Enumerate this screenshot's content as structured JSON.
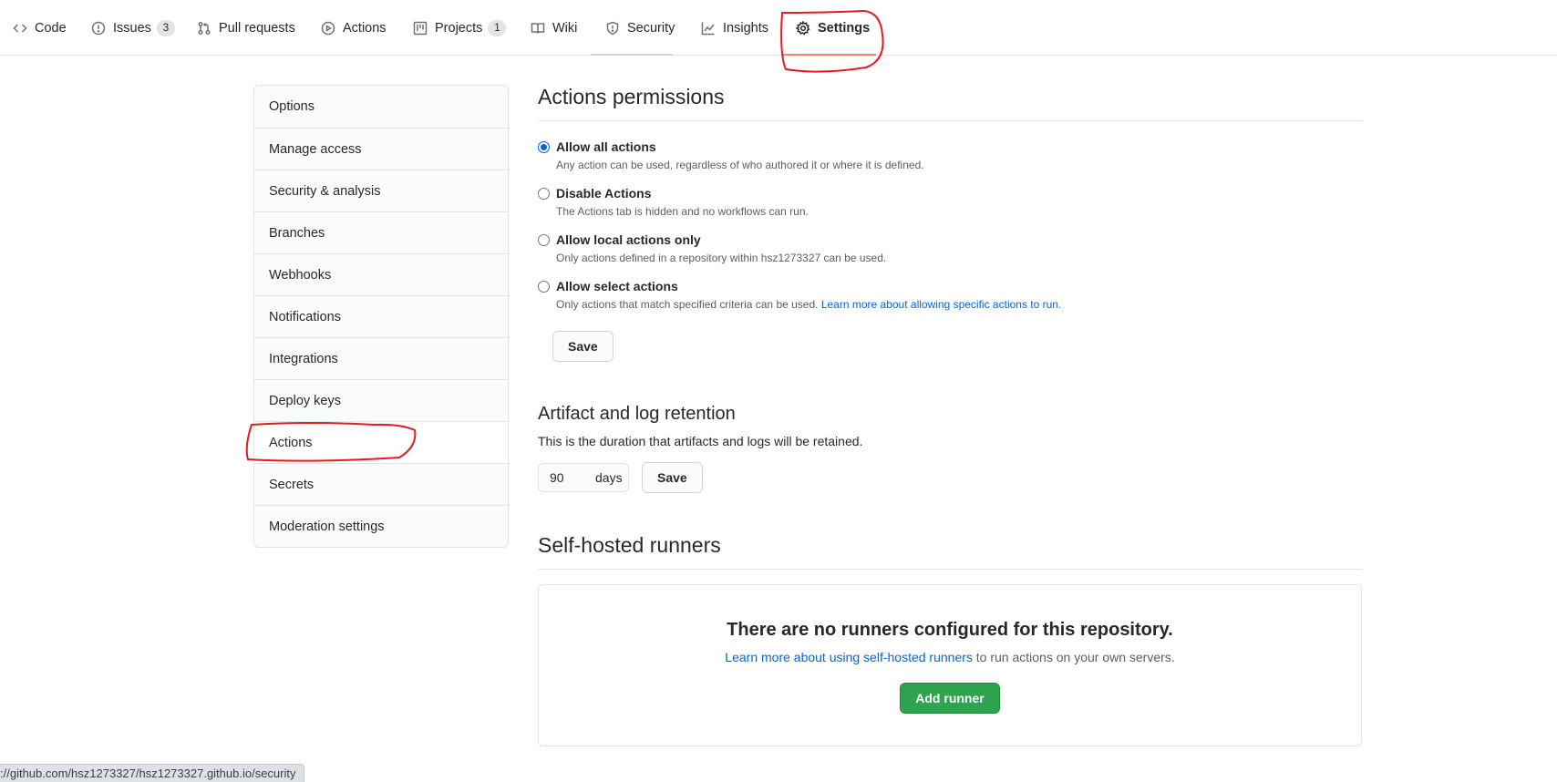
{
  "nav": {
    "tabs": [
      {
        "label": "Code",
        "icon": "code-icon"
      },
      {
        "label": "Issues",
        "icon": "issue-opened-icon",
        "count": "3"
      },
      {
        "label": "Pull requests",
        "icon": "git-pull-request-icon"
      },
      {
        "label": "Actions",
        "icon": "play-icon"
      },
      {
        "label": "Projects",
        "icon": "project-icon",
        "count": "1"
      },
      {
        "label": "Wiki",
        "icon": "book-icon"
      },
      {
        "label": "Security",
        "icon": "shield-icon"
      },
      {
        "label": "Insights",
        "icon": "graph-icon"
      },
      {
        "label": "Settings",
        "icon": "gear-icon",
        "selected": true
      }
    ]
  },
  "sidebar": {
    "items": [
      {
        "label": "Options"
      },
      {
        "label": "Manage access"
      },
      {
        "label": "Security & analysis"
      },
      {
        "label": "Branches"
      },
      {
        "label": "Webhooks"
      },
      {
        "label": "Notifications"
      },
      {
        "label": "Integrations"
      },
      {
        "label": "Deploy keys"
      },
      {
        "label": "Actions",
        "active": true
      },
      {
        "label": "Secrets"
      },
      {
        "label": "Moderation settings"
      }
    ]
  },
  "permissions": {
    "title": "Actions permissions",
    "options": [
      {
        "label": "Allow all actions",
        "note": "Any action can be used, regardless of who authored it or where it is defined.",
        "checked": true
      },
      {
        "label": "Disable Actions",
        "note": "The Actions tab is hidden and no workflows can run."
      },
      {
        "label": "Allow local actions only",
        "note": "Only actions defined in a repository within hsz1273327 can be used."
      },
      {
        "label": "Allow select actions",
        "note": "Only actions that match specified criteria can be used.",
        "link": "Learn more about allowing specific actions to run."
      }
    ],
    "save_label": "Save"
  },
  "retention": {
    "title": "Artifact and log retention",
    "note": "This is the duration that artifacts and logs will be retained.",
    "days_value": "90",
    "days_unit": "days",
    "save_label": "Save"
  },
  "runners": {
    "title": "Self-hosted runners",
    "empty_title": "There are no runners configured for this repository.",
    "empty_link": "Learn more about using self-hosted runners",
    "empty_text": "to run actions on your own servers.",
    "add_label": "Add runner"
  },
  "statusbar": {
    "url": "://github.com/hsz1273327/hsz1273327.github.io/security"
  },
  "colors": {
    "accent": "#0366d6",
    "selected_underline": "#f9826c",
    "primary_button": "#2ea44f",
    "annotation": "#e31b23"
  }
}
